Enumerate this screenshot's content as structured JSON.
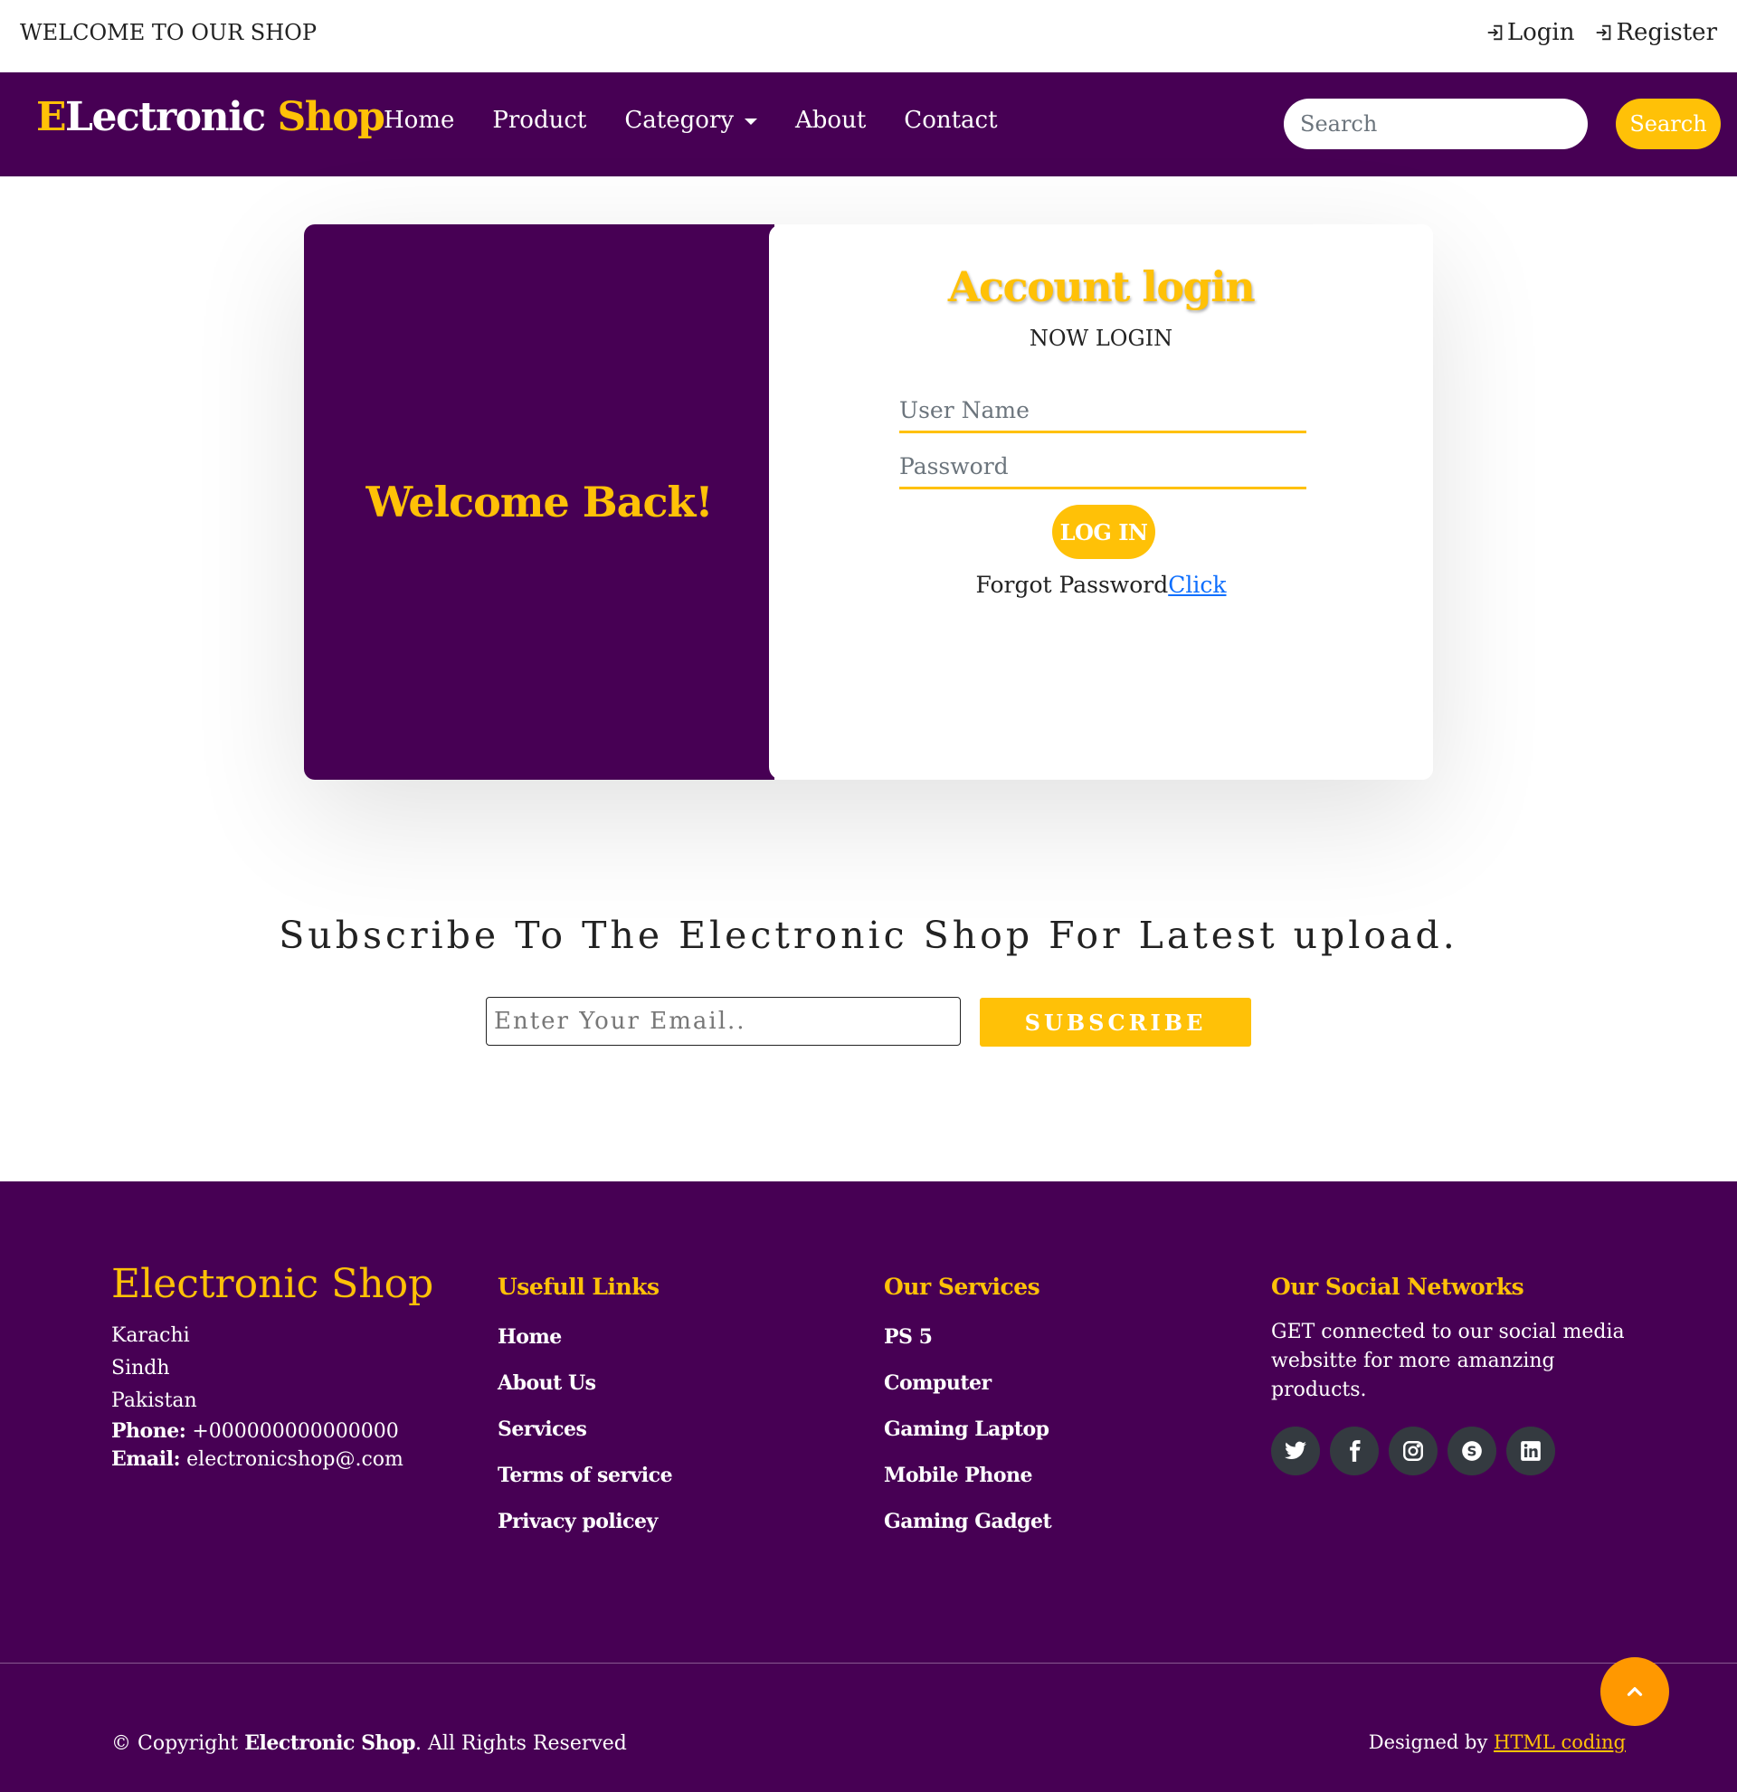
{
  "topbar": {
    "welcome": "WELCOME TO OUR SHOP",
    "login": "Login",
    "register": "Register",
    "login_icon": "sign-in-icon",
    "register_icon": "sign-in-icon"
  },
  "navbar": {
    "brand_first": "E",
    "brand_middle": "Lectronic",
    "brand_last": "Shop",
    "links": [
      "Home",
      "Product",
      "Category",
      "About",
      "Contact"
    ],
    "search_placeholder": "Search",
    "search_button": "Search"
  },
  "login_card": {
    "welcome": "Welcome Back!",
    "title": "Account login",
    "subtitle": "NOW LOGIN",
    "username_placeholder": "User Name",
    "password_placeholder": "Password",
    "login_button": "LOG IN",
    "forgot_text": "Forgot Password",
    "forgot_link": "Click"
  },
  "subscribe": {
    "title": "Subscribe To The Electronic Shop For Latest upload.",
    "email_placeholder": "Enter Your Email..",
    "button": "SUBSCRIBE"
  },
  "footer": {
    "brand": "Electronic Shop",
    "address": [
      "Karachi",
      "Sindh",
      "Pakistan"
    ],
    "phone_label": "Phone:",
    "phone": "+000000000000000",
    "email_label": "Email:",
    "email": "electronicshop@.com",
    "links_heading": "Usefull Links",
    "links": [
      "Home",
      "About Us",
      "Services",
      "Terms of service",
      "Privacy policey"
    ],
    "services_heading": "Our Services",
    "services": [
      "PS 5",
      "Computer",
      "Gaming Laptop",
      "Mobile Phone",
      "Gaming Gadget"
    ],
    "social_heading": "Our Social Networks",
    "social_text": "GET connected to our social media websitte for more amanzing products.",
    "social_icons": [
      "twitter-icon",
      "facebook-icon",
      "instagram-icon",
      "skype-icon",
      "linkedin-icon"
    ],
    "copyright_prefix": "© Copyright",
    "copyright_brand": "Electronic Shop",
    "copyright_suffix": ". All Rights Reserved",
    "designed_prefix": "Designed by",
    "designed_link": "HTML coding"
  },
  "colors": {
    "primary_purple": "#470054",
    "accent_yellow": "#ffc107",
    "back_to_top": "#ff9800",
    "link_blue": "#0d6efd"
  }
}
